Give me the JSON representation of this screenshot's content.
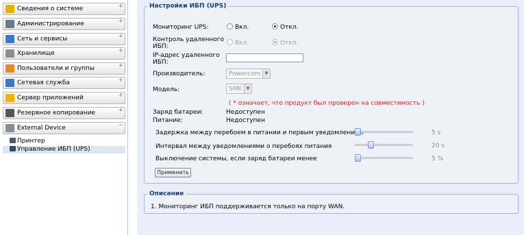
{
  "sidebar": {
    "items": [
      {
        "label": "Сведения о системе",
        "icon": "info-icon",
        "color": "#e5b100",
        "toggle": "+"
      },
      {
        "label": "Администрирование",
        "icon": "tools-icon",
        "color": "#6a7a8e",
        "toggle": "+"
      },
      {
        "label": "Сеть и сервисы",
        "icon": "network-icon",
        "color": "#3a78c8",
        "toggle": "+"
      },
      {
        "label": "Хранилище",
        "icon": "storage-icon",
        "color": "#8a8e94",
        "toggle": "+"
      },
      {
        "label": "Пользователи и группы",
        "icon": "users-icon",
        "color": "#e08a2a",
        "toggle": "+"
      },
      {
        "label": "Сетевая служба",
        "icon": "network-service-icon",
        "color": "#3a78c8",
        "toggle": "+"
      },
      {
        "label": "Сервер приложений",
        "icon": "app-server-icon",
        "color": "#f0b400",
        "toggle": "+"
      },
      {
        "label": "Резервное копирование",
        "icon": "backup-icon",
        "color": "#50585e",
        "toggle": "+"
      },
      {
        "label": "External Device",
        "icon": "external-device-icon",
        "color": "#8a8e94",
        "toggle": "−"
      }
    ],
    "subitems": [
      {
        "label": "Принтер",
        "icon": "printer-icon",
        "color": "#4a5a70"
      },
      {
        "label": "Управление ИБП (UPS)",
        "icon": "ups-icon",
        "color": "#304a6a"
      }
    ]
  },
  "ups": {
    "legend": "Настройки ИБП (UPS)",
    "monitoring_label": "Мониторинг UPS:",
    "monitoring_on": "Вкл.",
    "monitoring_off": "Откл.",
    "remote_label_line1": "Контроль удаленного",
    "remote_label_line2": "ИБП:",
    "remote_on": "Вкл.",
    "remote_off": "Откл.",
    "ip_label_line1": "IP-адрес удаленного",
    "ip_label_line2": "ИБП:",
    "ip_value": "",
    "manufacturer_label": "Производитель:",
    "manufacturer_value": "Powercom",
    "model_label": "Модель:",
    "model_value": "SMK",
    "note": "( * означает, что продукт был проверен на совместимость )",
    "battery_label": "Заряд батареи:",
    "battery_value": "Недоступен",
    "power_label": "Питание:",
    "power_value": "Недоступен",
    "delay_label": "Задержка между перебоем в питании и первым уведомлением",
    "delay_value": "5 s",
    "interval_label": "Интервал между уведомлениями о перебоях питания",
    "interval_value": "20 s",
    "shutdown_label": "Выключение системы, если заряд батареи менее",
    "shutdown_value": "5 %",
    "apply_button": "Применить"
  },
  "description": {
    "legend": "Описание",
    "text": "1. Мониторинг ИБП поддерживается только на порту WAN."
  },
  "sliders": {
    "delay_fraction": 0.0,
    "interval_fraction": 0.25,
    "shutdown_fraction": 0.0
  },
  "colors": {
    "legend": "#1a3d6e",
    "note": "#e02020",
    "main_bg": "#e8eef7",
    "selected_bg": "#dde5f0"
  }
}
